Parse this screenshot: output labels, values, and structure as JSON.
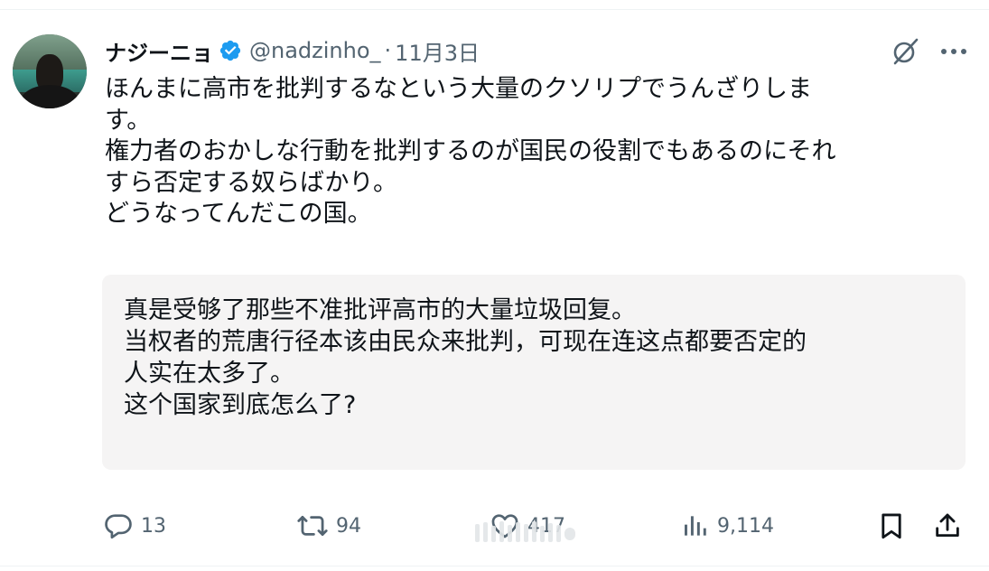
{
  "author": {
    "display_name": "ナジーニョ",
    "handle": "@nadzinho_",
    "separator": "·",
    "date": "11月3日",
    "verified": true
  },
  "header_icons": [
    "grok-icon",
    "more-icon"
  ],
  "tweet": {
    "lines": [
      "ほんまに高市を批判するなという大量のクソリプでうんざりしま",
      "す。",
      "権力者のおかしな行動を批判するのが国民の役割でもあるのにそれ",
      "すら否定する奴らばかり。",
      "どうなってんだこの国。"
    ]
  },
  "translation": {
    "lines": [
      "真是受够了那些不准批评高市的大量垃圾回复。",
      "当权者的荒唐行径本该由民众来批判，可现在连这点都要否定的",
      "人实在太多了。",
      "这个国家到底怎么了?"
    ]
  },
  "actions": {
    "reply_count": "13",
    "retweet_count": "94",
    "like_count": "417",
    "views_count": "9,114"
  },
  "colors": {
    "text": "#0f1419",
    "secondary": "#536471",
    "verified": "#1d9bf0",
    "translation_bg": "#f5f4f4"
  }
}
